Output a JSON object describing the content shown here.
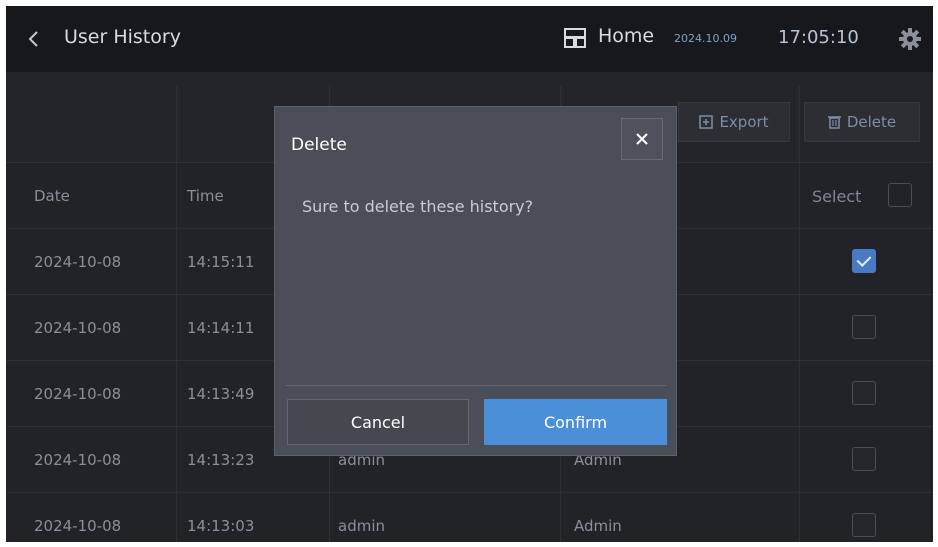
{
  "header": {
    "title": "User History",
    "home_label": "Home",
    "date": "2024.10.09",
    "clock": "17:05:10"
  },
  "toolbar": {
    "export_label": "Export",
    "delete_label": "Delete"
  },
  "table": {
    "columns": {
      "date": "Date",
      "time": "Time",
      "select": "Select"
    },
    "rows": [
      {
        "date": "2024-10-08",
        "time": "14:15:11",
        "user": "",
        "role": "",
        "checked": true
      },
      {
        "date": "2024-10-08",
        "time": "14:14:11",
        "user": "",
        "role": "",
        "checked": false
      },
      {
        "date": "2024-10-08",
        "time": "14:13:49",
        "user": "",
        "role": "",
        "checked": false
      },
      {
        "date": "2024-10-08",
        "time": "14:13:23",
        "user": "admin",
        "role": "Admin",
        "checked": false
      },
      {
        "date": "2024-10-08",
        "time": "14:13:03",
        "user": "admin",
        "role": "Admin",
        "checked": false
      }
    ]
  },
  "modal": {
    "title": "Delete",
    "message": "Sure to delete these history?",
    "cancel_label": "Cancel",
    "confirm_label": "Confirm"
  },
  "colors": {
    "accent": "#4a8fd8",
    "background": "#222326",
    "modal": "#4a4e58"
  },
  "icons": [
    "chevron-left-icon",
    "home-icon",
    "gear-icon",
    "export-icon",
    "trash-icon",
    "close-icon",
    "checkbox-icon"
  ]
}
